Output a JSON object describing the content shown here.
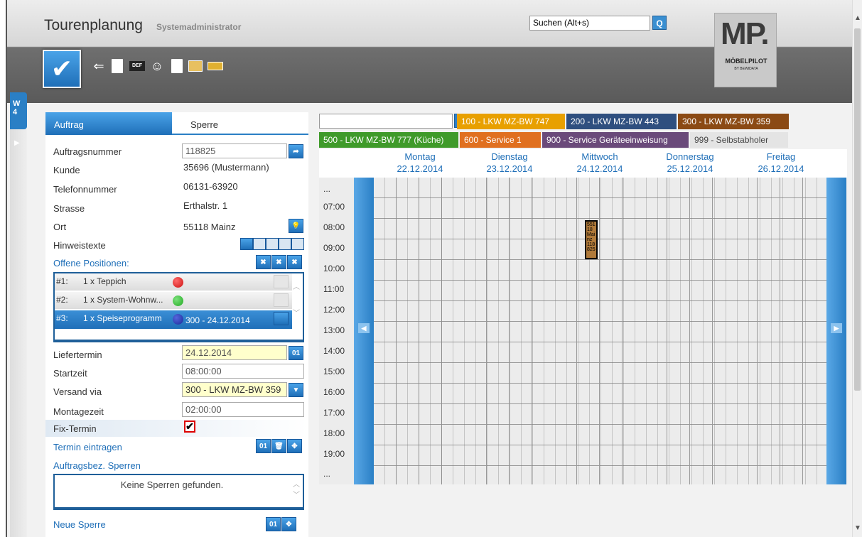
{
  "header": {
    "title": "Tourenplanung",
    "subtitle": "Systemadministrator",
    "search_value": "Suchen (Alt+s)",
    "logo_text": "MP.",
    "logo_brand": "MÖBELPILOT",
    "logo_by": "BY BEWIDATA"
  },
  "side_tab": {
    "line1": "W",
    "line2": "4"
  },
  "form": {
    "tabs": [
      {
        "label": "Auftrag"
      },
      {
        "label": "Sperre"
      }
    ],
    "auftragsnummer": {
      "label": "Auftragsnummer",
      "value": "118825"
    },
    "kunde": {
      "label": "Kunde",
      "value": "35696 (Mustermann)"
    },
    "telefon": {
      "label": "Telefonnummer",
      "value": "06131-63920"
    },
    "strasse": {
      "label": "Strasse",
      "value": "Erthalstr. 1"
    },
    "ort": {
      "label": "Ort",
      "value": "55118 Mainz"
    },
    "hinweistexte": {
      "label": "Hinweistexte"
    },
    "offene_positionen": {
      "label": "Offene Positionen:",
      "items": [
        {
          "num": "#1:",
          "text": "1 x Teppich",
          "dot_color": "#cc1111",
          "extra": ""
        },
        {
          "num": "#2:",
          "text": "1 x System-Wohnw...",
          "dot_color": "#22aa22",
          "extra": ""
        },
        {
          "num": "#3:",
          "text": "1 x Speiseprogramm",
          "dot_color": "#1a2a99",
          "extra": "300 - 24.12.2014"
        }
      ]
    },
    "liefertermin": {
      "label": "Liefertermin",
      "value": "24.12.2014"
    },
    "startzeit": {
      "label": "Startzeit",
      "value": "08:00:00"
    },
    "versand": {
      "label": "Versand via",
      "value": "300 - LKW MZ-BW 359"
    },
    "montagezeit": {
      "label": "Montagezeit",
      "value": "02:00:00"
    },
    "fix_termin": {
      "label": "Fix-Termin",
      "checked": "✔"
    },
    "termin_eintragen": {
      "label": "Termin eintragen"
    },
    "auftragsbez_sperren": {
      "label": "Auftragsbez. Sperren",
      "empty_text": "Keine Sperren gefunden."
    },
    "neue_sperre": {
      "label": "Neue Sperre"
    }
  },
  "planner": {
    "trucks_row1": [
      {
        "label": "100 - LKW MZ-BW 747",
        "color": "#e8a000"
      },
      {
        "label": "200 - LKW MZ-BW 443",
        "color": "#2f4f7f"
      },
      {
        "label": "300 - LKW MZ-BW 359",
        "color": "#8b4a14"
      }
    ],
    "trucks_row2": [
      {
        "label": "500 - LKW MZ-BW 777 (Küche)",
        "color": "#3f9a2a"
      },
      {
        "label": "600 - Service 1",
        "color": "#e07020"
      },
      {
        "label": "900 - Service Geräteeinweisung",
        "color": "#6a4a7a"
      },
      {
        "label": "999 - Selbstabholer",
        "color": "#e4e4e4"
      }
    ],
    "days": [
      {
        "name": "Montag",
        "date": "22.12.2014"
      },
      {
        "name": "Dienstag",
        "date": "23.12.2014"
      },
      {
        "name": "Mittwoch",
        "date": "24.12.2014"
      },
      {
        "name": "Donnerstag",
        "date": "25.12.2014"
      },
      {
        "name": "Freitag",
        "date": "26.12.2014"
      }
    ],
    "times": [
      "...",
      "07:00",
      "08:00",
      "09:00",
      "10:00",
      "11:00",
      "12:00",
      "13:00",
      "14:00",
      "15:00",
      "16:00",
      "17:00",
      "18:00",
      "19:00",
      "..."
    ],
    "appointment": {
      "text": "551 18 Mai nz 118 825"
    }
  }
}
